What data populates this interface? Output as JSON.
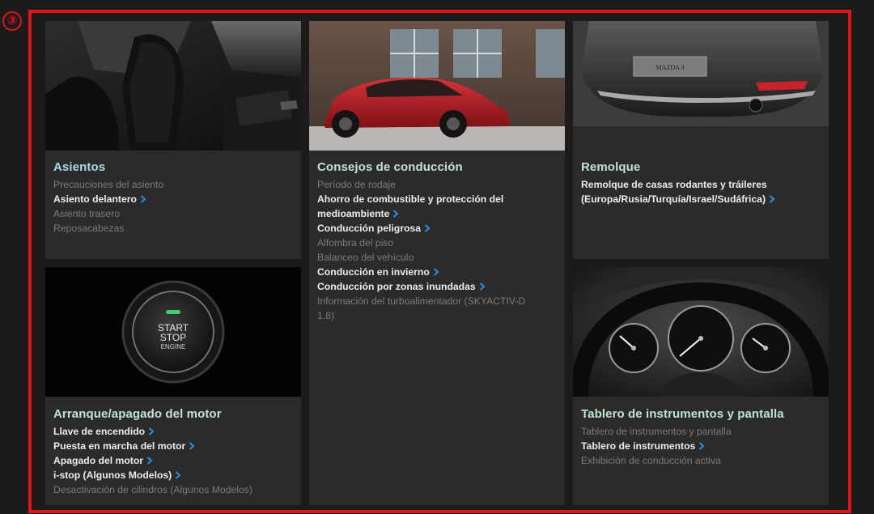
{
  "annotation": {
    "number": "③",
    "color": "#e1141a"
  },
  "cards": {
    "asientos": {
      "title": "Asientos",
      "items": [
        {
          "label": "Precauciones del asiento",
          "link": false
        },
        {
          "label": "Asiento delantero",
          "link": true
        },
        {
          "label": "Asiento trasero",
          "link": false
        },
        {
          "label": "Reposacabezas",
          "link": false
        }
      ]
    },
    "consejos": {
      "title": "Consejos de conducción",
      "items": [
        {
          "label": "Período de rodaje",
          "link": false
        },
        {
          "label": "Ahorro de combustible y protección del",
          "link": false
        },
        {
          "label": "medioambiente",
          "link": true
        },
        {
          "label": "Conducción peligrosa",
          "link": true
        },
        {
          "label": "Alfombra del piso",
          "link": false
        },
        {
          "label": "Balanceo del vehículo",
          "link": false
        },
        {
          "label": "Conducción en invierno",
          "link": true
        },
        {
          "label": "Conducción por zonas inundadas",
          "link": true
        },
        {
          "label": "Información del turboalimentador (SKYACTIV-D",
          "link": false
        },
        {
          "label": "1.8)",
          "link": false
        }
      ]
    },
    "remolque": {
      "title": "Remolque",
      "items": [
        {
          "label": "Remolque de casas rodantes y tráileres",
          "link": false
        },
        {
          "label": "(Europa/Rusia/Turquía/Israel/Sudáfrica)",
          "link": true
        }
      ],
      "plate_text": "MAZDA 3"
    },
    "arranque": {
      "title": "Arranque/apagado del motor",
      "items": [
        {
          "label": "Llave de encendido",
          "link": true
        },
        {
          "label": "Puesta en marcha del motor",
          "link": true
        },
        {
          "label": "Apagado del motor",
          "link": true
        },
        {
          "label": "i-stop (Algunos Modelos)",
          "link": true
        },
        {
          "label": "Desactivación de cilindros (Algunos Modelos)",
          "link": false
        }
      ],
      "button_text": {
        "line1": "START",
        "line2": "STOP",
        "line3": "ENGINE"
      }
    },
    "tablero": {
      "title": "Tablero de instrumentos y pantalla",
      "items": [
        {
          "label": "Tablero de instrumentos y pantalla",
          "link": false
        },
        {
          "label": "Tablero de instrumentos",
          "link": true
        },
        {
          "label": "Exhibición de conducción activa",
          "link": false
        }
      ]
    }
  },
  "colors": {
    "title_green": "#bfe3cf",
    "title_blue": "#a6dbe6",
    "link_text": "#ececec",
    "muted_text": "#7b7b7b",
    "chevron": "#2a8fe0",
    "card_bg": "#2b2b2b"
  },
  "icons": {
    "link_chevron": "chevron-right-icon"
  }
}
